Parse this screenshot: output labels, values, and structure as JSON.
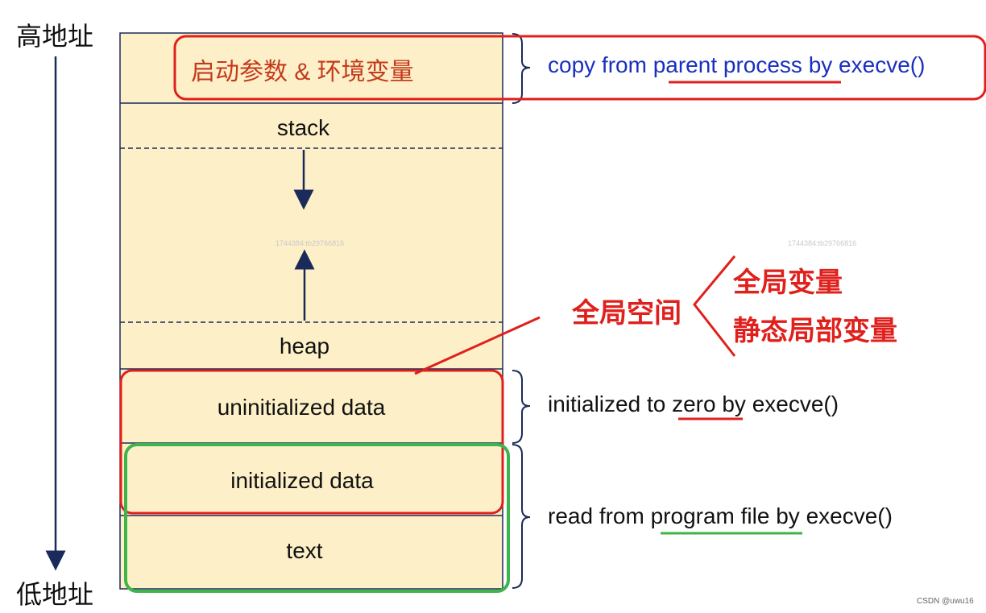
{
  "axis": {
    "high_label": "高地址",
    "low_label": "低地址"
  },
  "segments": {
    "env": "启动参数 & 环境变量",
    "stack": "stack",
    "heap": "heap",
    "bss": "uninitialized data",
    "data": "initialized data",
    "text": "text"
  },
  "annotations": {
    "env_prefix": "copy from ",
    "env_underlined": "parent process",
    "env_suffix": " by execve()",
    "bss_prefix": "initialized to ",
    "bss_underlined": "zero",
    "bss_suffix": " by execve()",
    "text_prefix": "read from ",
    "text_underlined": "program file",
    "text_suffix": " by execve()"
  },
  "global_space": {
    "label": "全局空间",
    "items": [
      "全局变量",
      "静态局部变量"
    ]
  },
  "watermarks": [
    "1744384:tb29766816",
    "1744384:tb29766816"
  ],
  "credit": "CSDN @uwu16",
  "colors": {
    "segment_fill": "#fdf0c8",
    "frame": "#1a2a5a",
    "red": "#e0201c",
    "green": "#3db54a",
    "blue_text": "#1a2fc0"
  }
}
